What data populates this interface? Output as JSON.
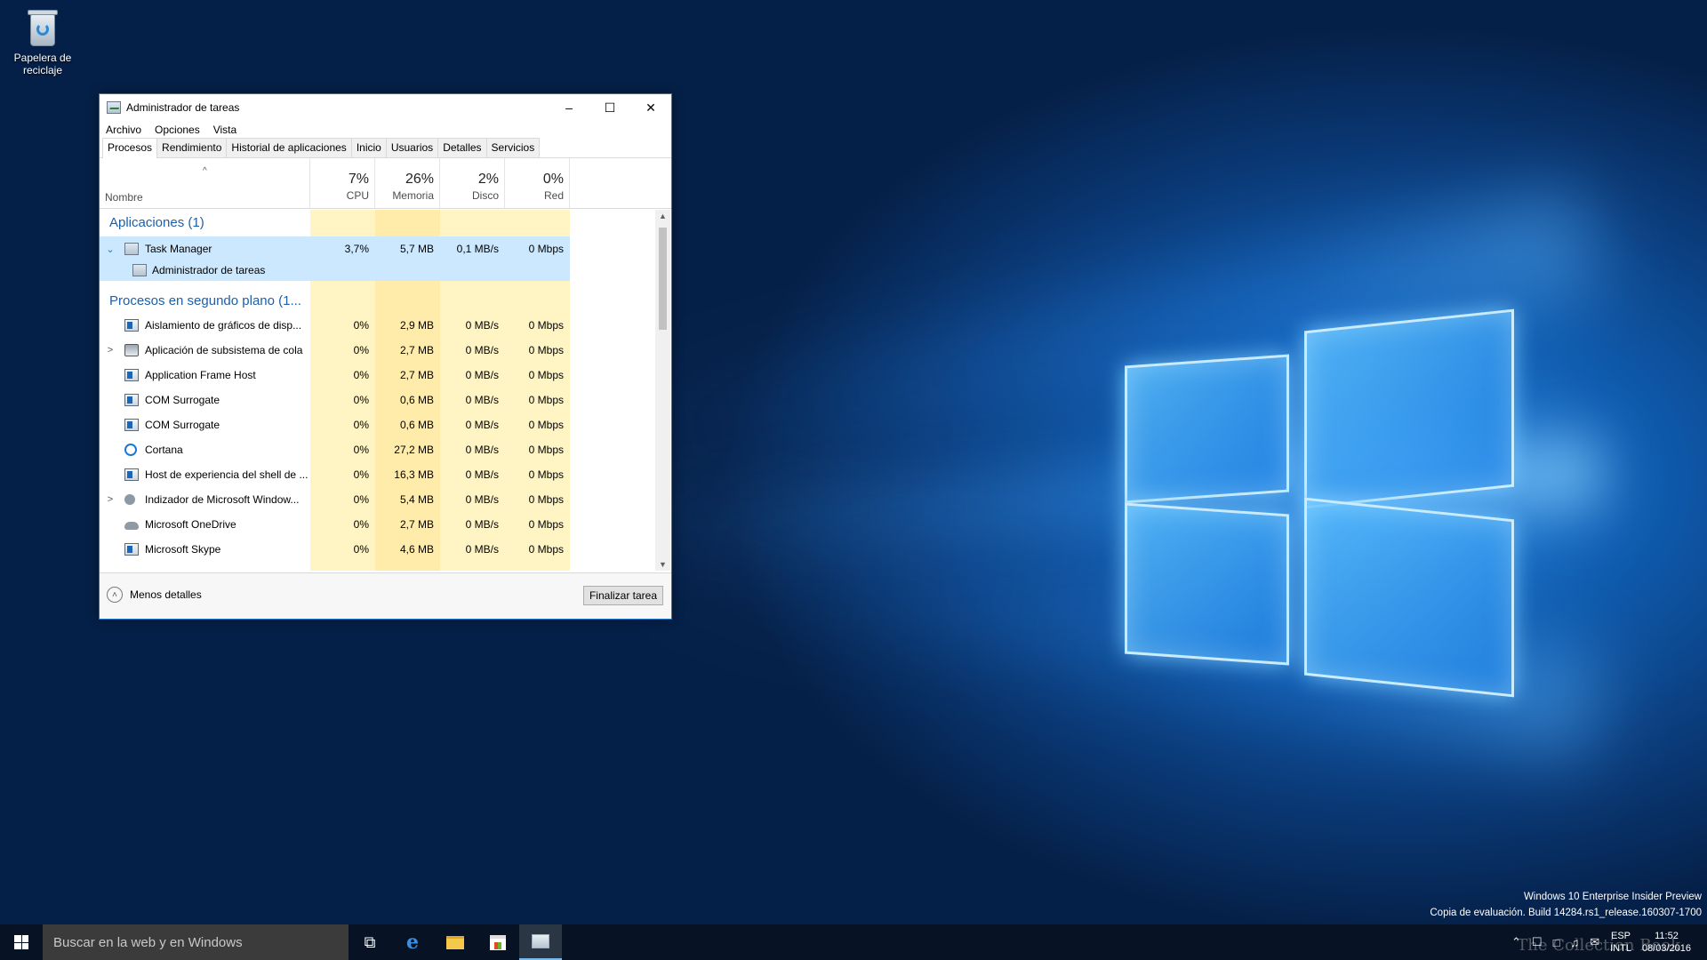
{
  "desktop": {
    "recycle_bin": "Papelera de reciclaje"
  },
  "window": {
    "title": "Administrador de tareas",
    "minimize_glyph": "–",
    "maximize_glyph": "☐",
    "close_glyph": "✕",
    "menu": [
      "Archivo",
      "Opciones",
      "Vista"
    ],
    "tabs": [
      "Procesos",
      "Rendimiento",
      "Historial de aplicaciones",
      "Inicio",
      "Usuarios",
      "Detalles",
      "Servicios"
    ],
    "active_tab": "Procesos",
    "columns": {
      "name": "Nombre",
      "sort_glyph": "^",
      "cpu": {
        "pct": "7%",
        "label": "CPU"
      },
      "mem": {
        "pct": "26%",
        "label": "Memoria"
      },
      "disk": {
        "pct": "2%",
        "label": "Disco"
      },
      "net": {
        "pct": "0%",
        "label": "Red"
      }
    },
    "groups": {
      "apps": "Aplicaciones (1)",
      "background": "Procesos en segundo plano (1..."
    },
    "app_row": {
      "name": "Task Manager",
      "cpu": "3,7%",
      "mem": "5,7 MB",
      "disk": "0,1 MB/s",
      "net": "0 Mbps",
      "expander": "⌄"
    },
    "app_child": "Administrador de tareas",
    "processes": [
      {
        "name": "Aislamiento de gráficos de disp...",
        "cpu": "0%",
        "mem": "2,9 MB",
        "disk": "0 MB/s",
        "net": "0 Mbps",
        "icon": "app-window-icon",
        "expander": ""
      },
      {
        "name": "Aplicación de subsistema de cola",
        "cpu": "0%",
        "mem": "2,7 MB",
        "disk": "0 MB/s",
        "net": "0 Mbps",
        "icon": "printer-icon",
        "expander": ">"
      },
      {
        "name": "Application Frame Host",
        "cpu": "0%",
        "mem": "2,7 MB",
        "disk": "0 MB/s",
        "net": "0 Mbps",
        "icon": "app-window-icon",
        "expander": ""
      },
      {
        "name": "COM Surrogate",
        "cpu": "0%",
        "mem": "0,6 MB",
        "disk": "0 MB/s",
        "net": "0 Mbps",
        "icon": "app-window-icon",
        "expander": ""
      },
      {
        "name": "COM Surrogate",
        "cpu": "0%",
        "mem": "0,6 MB",
        "disk": "0 MB/s",
        "net": "0 Mbps",
        "icon": "app-window-icon",
        "expander": ""
      },
      {
        "name": "Cortana",
        "cpu": "0%",
        "mem": "27,2 MB",
        "disk": "0 MB/s",
        "net": "0 Mbps",
        "icon": "cortana-icon",
        "expander": ""
      },
      {
        "name": "Host de experiencia del shell de ...",
        "cpu": "0%",
        "mem": "16,3 MB",
        "disk": "0 MB/s",
        "net": "0 Mbps",
        "icon": "app-window-icon",
        "expander": ""
      },
      {
        "name": "Indizador de Microsoft Window...",
        "cpu": "0%",
        "mem": "5,4 MB",
        "disk": "0 MB/s",
        "net": "0 Mbps",
        "icon": "user-icon",
        "expander": ">"
      },
      {
        "name": "Microsoft OneDrive",
        "cpu": "0%",
        "mem": "2,7 MB",
        "disk": "0 MB/s",
        "net": "0 Mbps",
        "icon": "cloud-icon",
        "expander": ""
      },
      {
        "name": "Microsoft Skype",
        "cpu": "0%",
        "mem": "4,6 MB",
        "disk": "0 MB/s",
        "net": "0 Mbps",
        "icon": "app-window-icon",
        "expander": ""
      }
    ],
    "scroll_up": "▲",
    "scroll_down": "▼",
    "less_glyph": "˄",
    "less_details": "Menos detalles",
    "end_task": "Finalizar tarea"
  },
  "taskbar": {
    "search_placeholder": "Buscar en la web y en Windows",
    "edge_glyph": "e",
    "task_view_glyph": "⧉",
    "tray_glyphs": [
      "⌃",
      "☐",
      "□",
      "♫",
      "✉"
    ],
    "lang_top": "ESP",
    "lang_bottom": "INTL",
    "time": "11:52",
    "date": "08/03/2016"
  },
  "watermark": {
    "line1": "Windows 10 Enterprise Insider Preview",
    "line2": "Copia de evaluación. Build 14284.rs1_release.160307-1700",
    "book": "The Collection Book"
  },
  "colors": {
    "accent": "#1979ca",
    "group_text": "#1e5fa8",
    "selected_row": "#cce8ff",
    "heat_light": "#fff4c4",
    "heat_medium": "#ffecab"
  }
}
